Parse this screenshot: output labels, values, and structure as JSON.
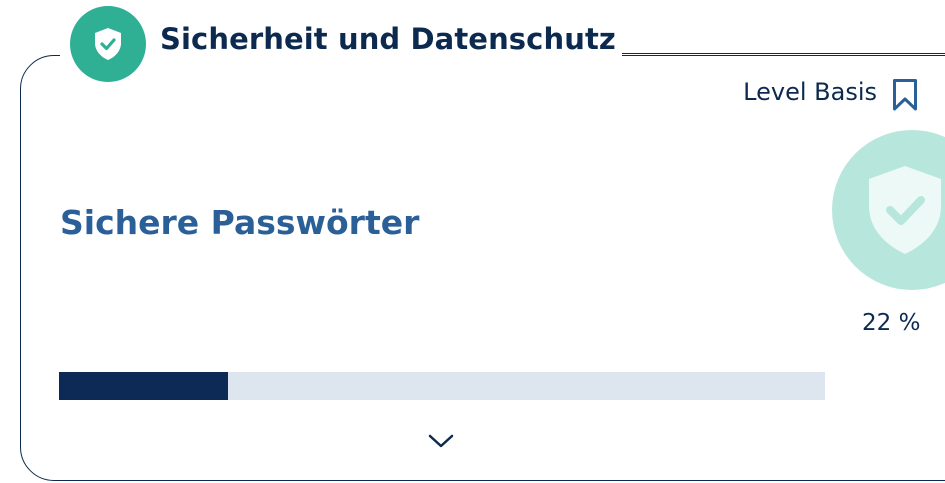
{
  "section": {
    "title": "Sicherheit und Datenschutz",
    "icon": "shield-check-icon",
    "badge_color": "#2fb094"
  },
  "card": {
    "level_label": "Level Basis",
    "bookmark_icon": "bookmark-icon",
    "topic_title": "Sichere Passwörter",
    "progress_percent_text": "22 %",
    "progress_fraction": 0.22,
    "progress_ring_color": "#b7e6dc",
    "bar_fill_color": "#0c2a55",
    "bar_track_color": "#dde5ee",
    "expand_icon": "chevron-down-icon"
  }
}
